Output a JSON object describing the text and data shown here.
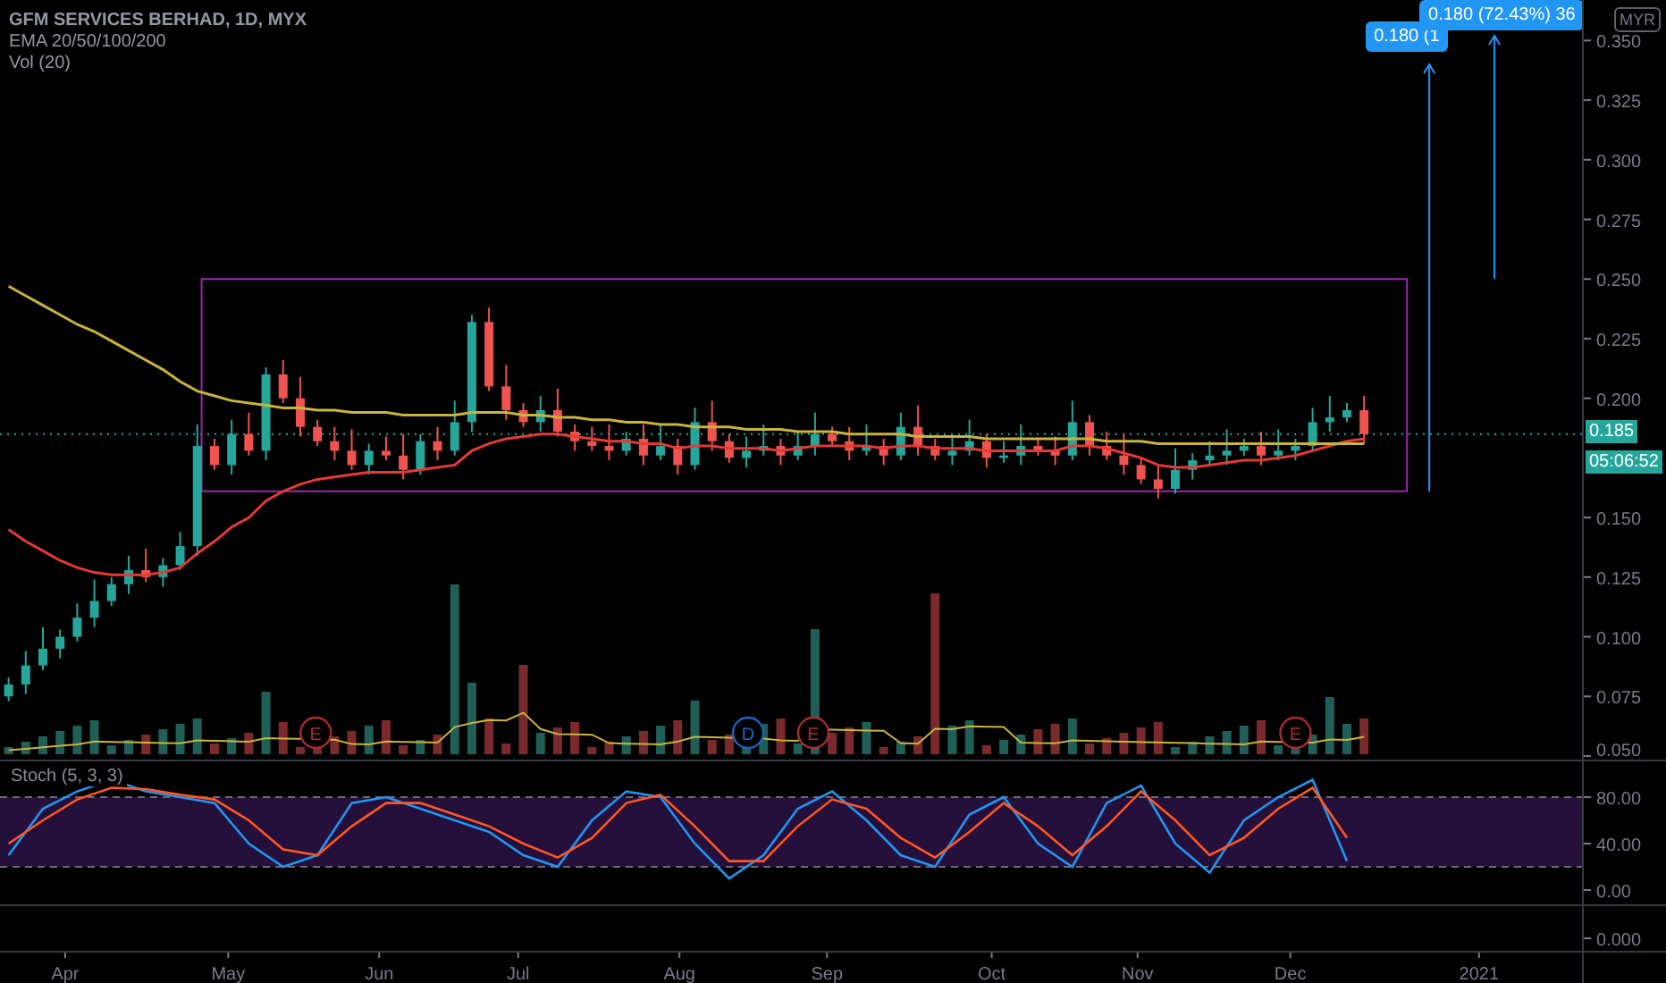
{
  "legend": {
    "title": "GFM SERVICES BERHAD, 1D, MYX",
    "lines": [
      "EMA 20/50/100/200",
      "Vol (20)"
    ]
  },
  "price_pane": {
    "currency": "MYR",
    "last_price": "0.185",
    "countdown": "05:06:52",
    "axis_labels": [
      "0.350",
      "0.325",
      "0.300",
      "0.275",
      "0.250",
      "0.225",
      "0.200",
      "0.150",
      "0.125",
      "0.100",
      "0.075",
      "0.050"
    ],
    "measure_labels": [
      "0.180 (1",
      "0.180 (72.43%) 36"
    ],
    "events": [
      {
        "label": "E",
        "color": "#b22833"
      },
      {
        "label": "D",
        "color": "#1e63c4"
      },
      {
        "label": "E",
        "color": "#b22833"
      },
      {
        "label": "E",
        "color": "#b22833"
      }
    ]
  },
  "stoch_pane": {
    "title": "Stoch (5, 3, 3)",
    "axis_labels": [
      "80.00",
      "40.00",
      "0.00"
    ]
  },
  "lower_pane": {
    "tick": "0.000"
  },
  "time_axis": [
    "Apr",
    "May",
    "Jun",
    "Jul",
    "Aug",
    "Sep",
    "Oct",
    "Nov",
    "Dec",
    "2021"
  ]
}
